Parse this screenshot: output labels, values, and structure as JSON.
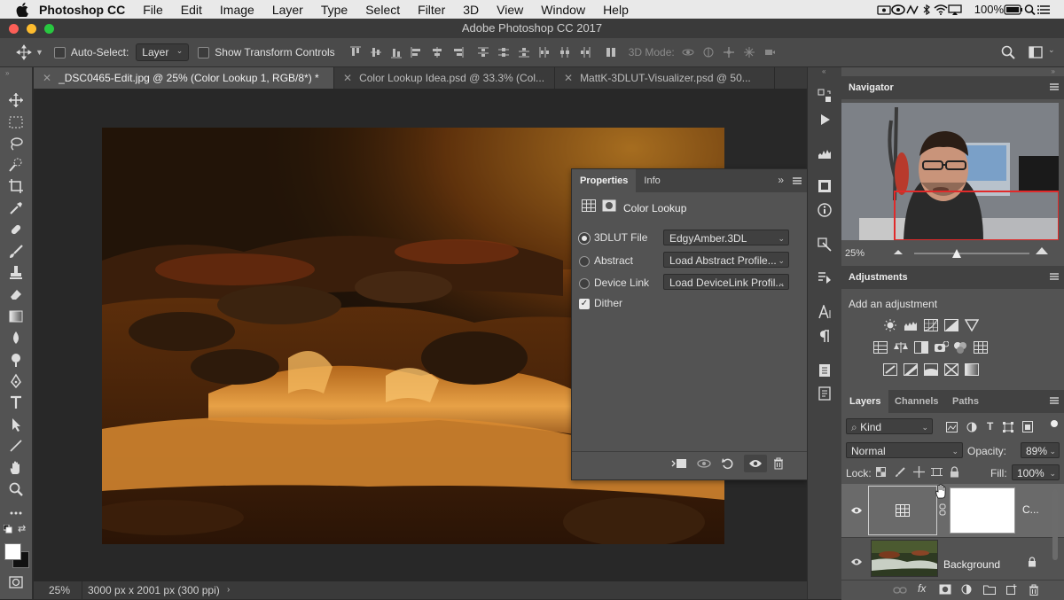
{
  "menubar": {
    "items": [
      "Photoshop CC",
      "File",
      "Edit",
      "Image",
      "Layer",
      "Type",
      "Select",
      "Filter",
      "3D",
      "View",
      "Window",
      "Help"
    ],
    "battery": "100%"
  },
  "window": {
    "title": "Adobe Photoshop CC 2017"
  },
  "options": {
    "auto_select_label": "Auto-Select:",
    "auto_select_value": "Layer",
    "show_transform_label": "Show Transform Controls",
    "mode_3d_label": "3D Mode:"
  },
  "tabs": [
    {
      "label": "_DSC0465-Edit.jpg @ 25% (Color Lookup 1, RGB/8*) *"
    },
    {
      "label": "Color Lookup Idea.psd @ 33.3% (Col..."
    },
    {
      "label": "MattK-3DLUT-Visualizer.psd @ 50..."
    }
  ],
  "status": {
    "zoom": "25%",
    "doc_info": "3000 px x 2001 px (300 ppi)"
  },
  "properties": {
    "tab_properties": "Properties",
    "tab_info": "Info",
    "title": "Color Lookup",
    "rows": [
      {
        "label": "3DLUT File",
        "value": "EdgyAmber.3DL"
      },
      {
        "label": "Abstract",
        "value": "Load Abstract Profile..."
      },
      {
        "label": "Device Link",
        "value": "Load DeviceLink Profil..."
      }
    ],
    "dither_label": "Dither"
  },
  "navigator": {
    "title": "Navigator",
    "zoom": "25%"
  },
  "adjustments": {
    "title": "Adjustments",
    "subtitle": "Add an adjustment"
  },
  "layers": {
    "tabs": [
      "Layers",
      "Channels",
      "Paths"
    ],
    "filter_kind": "Kind",
    "blend_mode": "Normal",
    "opacity_label": "Opacity:",
    "opacity_value": "89%",
    "lock_label": "Lock:",
    "fill_label": "Fill:",
    "fill_value": "100%",
    "layer1_name": "C...",
    "background_name": "Background"
  }
}
